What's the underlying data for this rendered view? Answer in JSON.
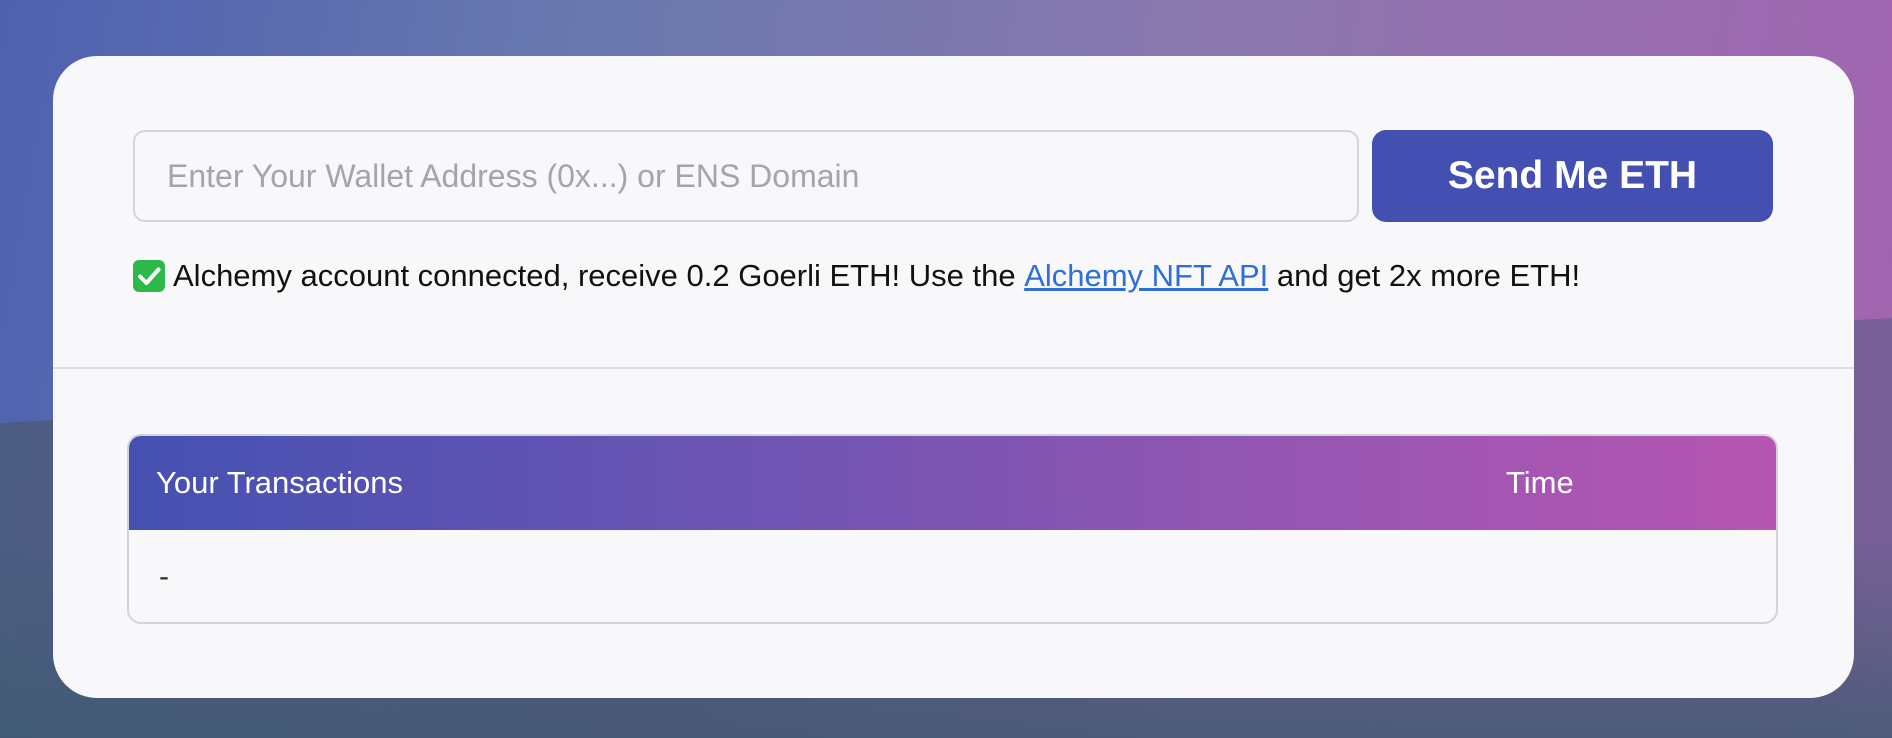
{
  "faucet": {
    "wallet_input": {
      "value": "",
      "placeholder": "Enter Your Wallet Address (0x...) or ENS Domain"
    },
    "send_button_label": "Send Me ETH",
    "status": {
      "icon": "check-mark-icon",
      "text_before": "Alchemy account connected, receive 0.2 Goerli ETH! Use the ",
      "link_text": "Alchemy NFT API",
      "text_after": " and get 2x more ETH!"
    }
  },
  "transactions": {
    "columns": [
      "Your Transactions",
      "Time"
    ],
    "rows": [
      {
        "tx": "-",
        "time": ""
      }
    ]
  },
  "colors": {
    "button": "#444fb2",
    "link": "#2c6fd8",
    "check": "#2db84b",
    "header_gradient_start": "#4551b2",
    "header_gradient_end": "#b656b2"
  }
}
